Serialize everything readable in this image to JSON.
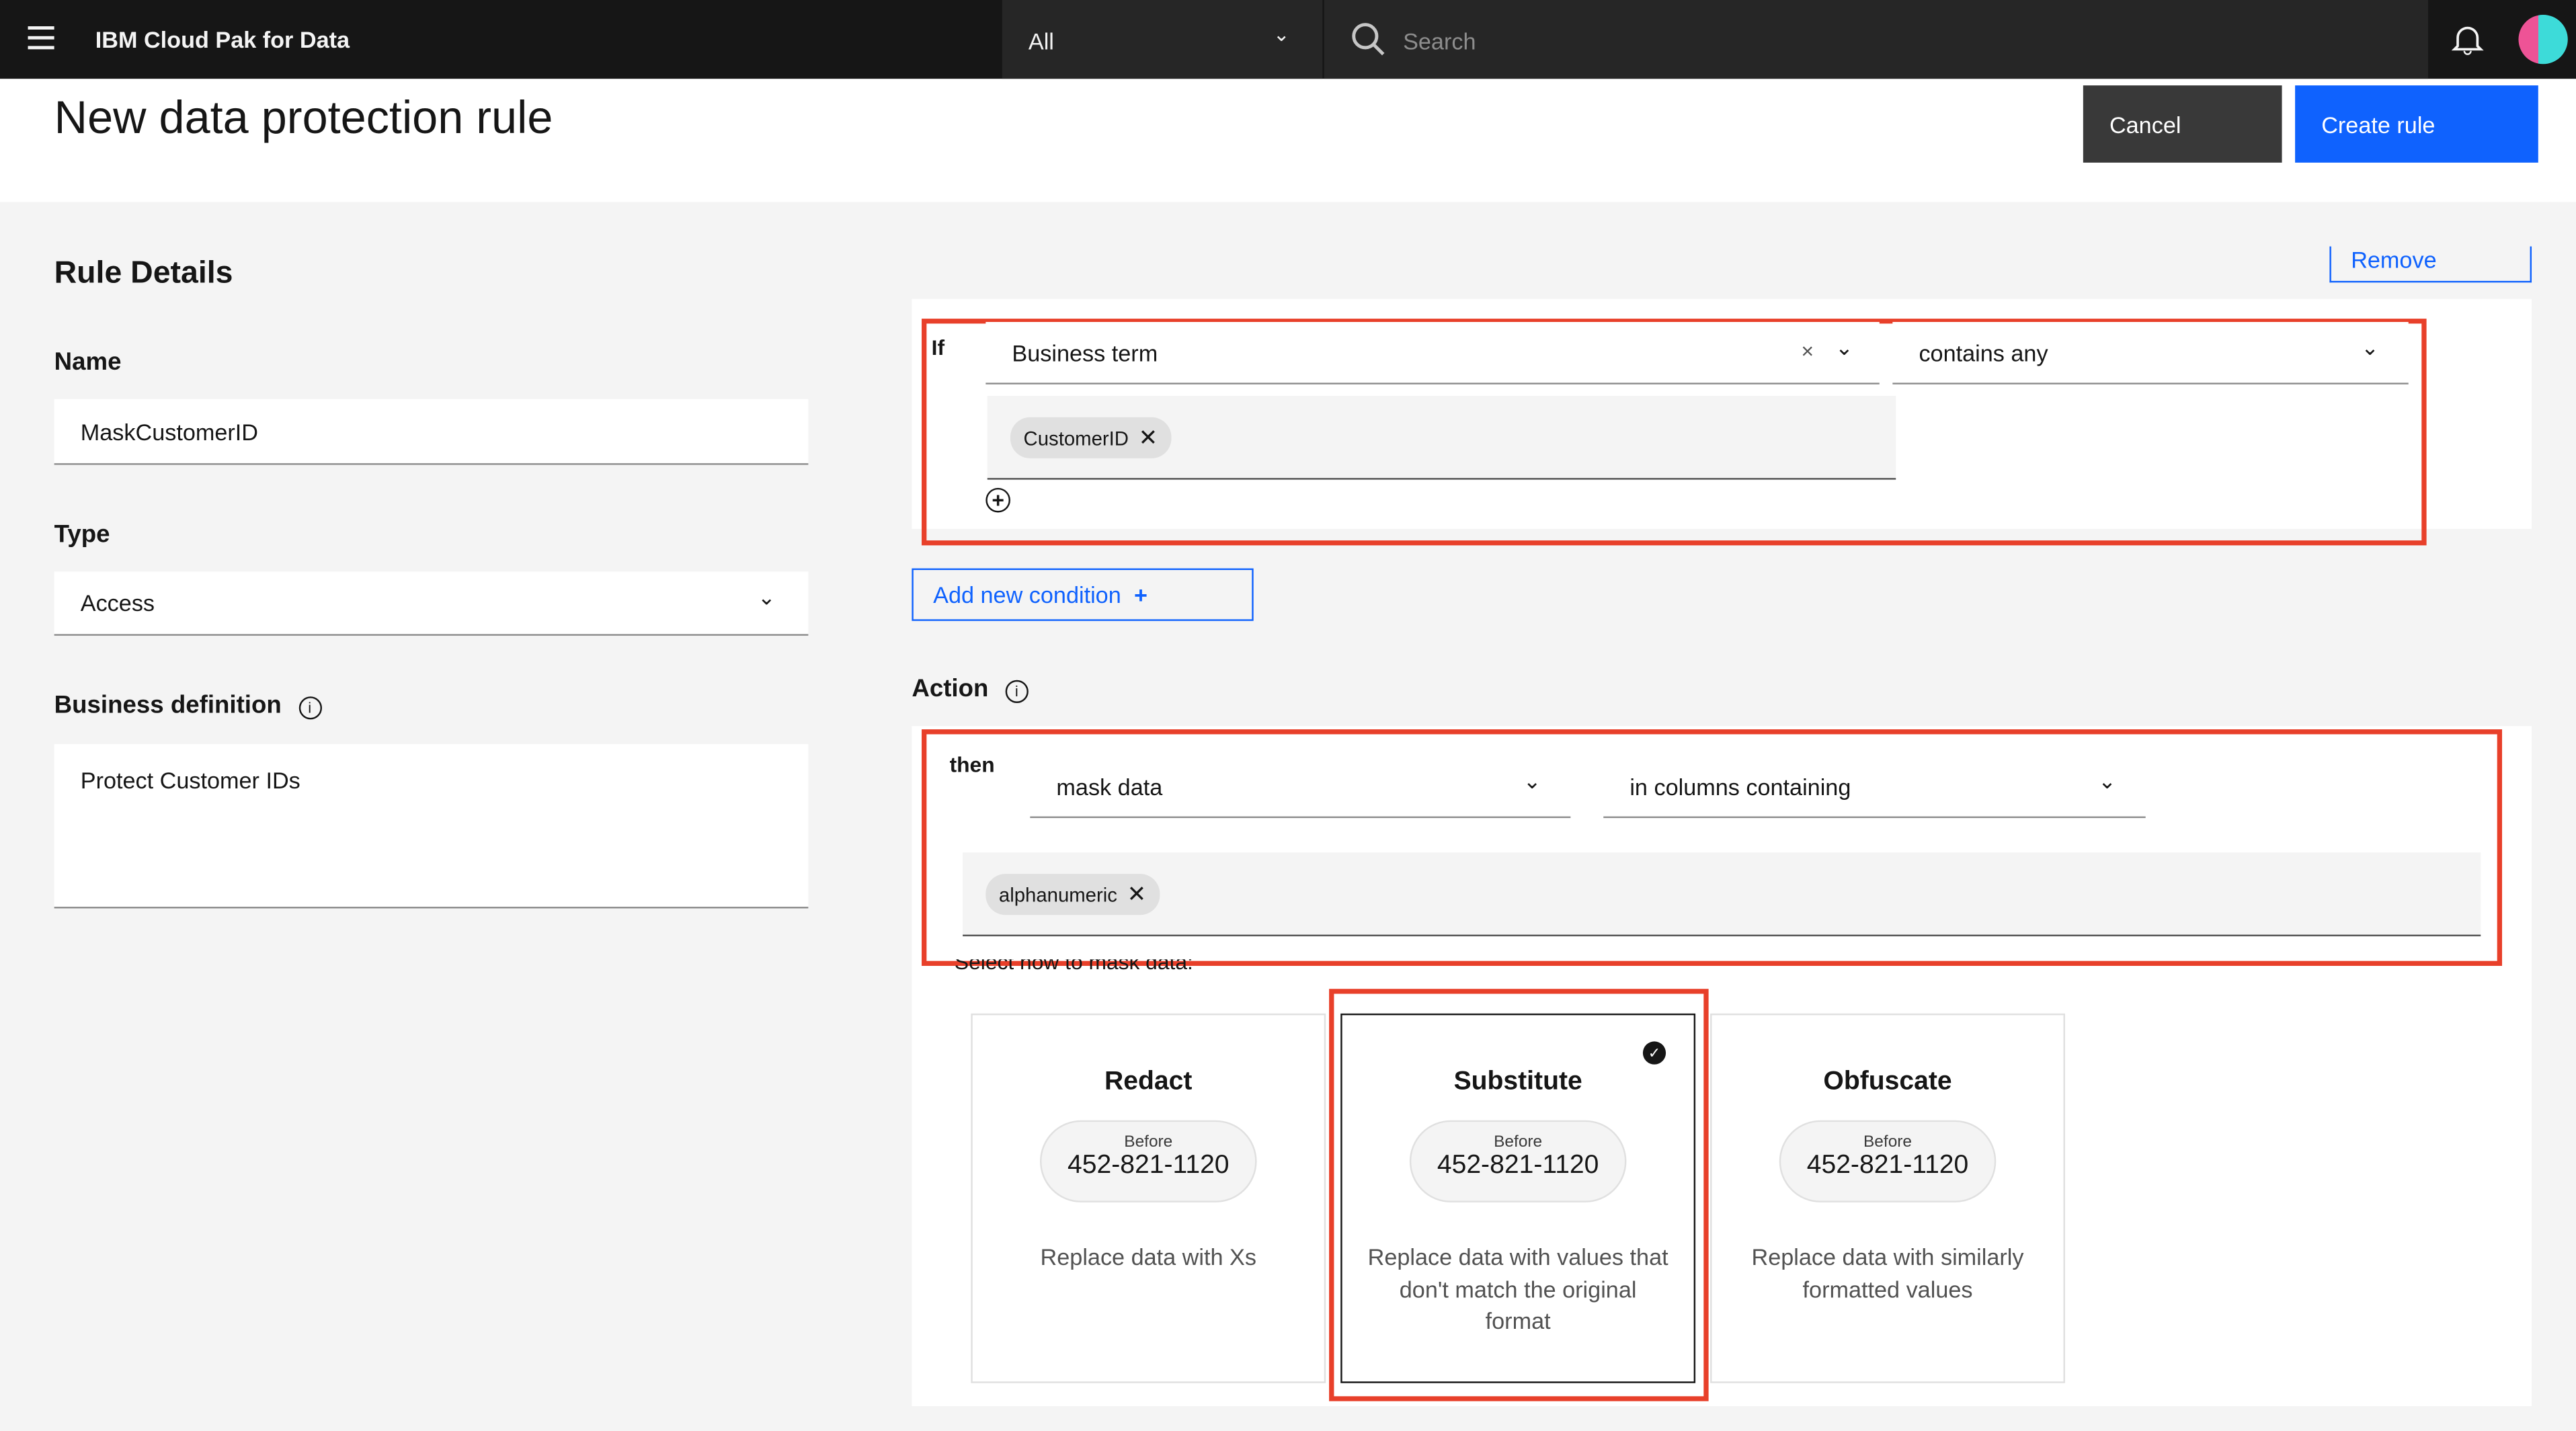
{
  "topbar": {
    "app_title": "IBM Cloud Pak for Data",
    "scope": "All",
    "search_placeholder": "Search"
  },
  "header": {
    "title": "New data protection rule",
    "cancel": "Cancel",
    "create": "Create rule"
  },
  "details": {
    "heading": "Rule Details",
    "name_label": "Name",
    "name_value": "MaskCustomerID",
    "type_label": "Type",
    "type_value": "Access",
    "definition_label": "Business definition",
    "definition_value": "Protect Customer IDs"
  },
  "condition": {
    "remove": "Remove",
    "if": "If",
    "property": "Business term",
    "operator": "contains any",
    "tags": [
      "CustomerID"
    ],
    "add_condition": "Add new condition"
  },
  "action": {
    "heading": "Action",
    "then": "then",
    "verb": "mask data",
    "scope": "in columns containing",
    "tags": [
      "alphanumeric"
    ],
    "select_label": "Select how to mask data:",
    "options": [
      {
        "title": "Redact",
        "before": "Before",
        "sample": "452-821-1120",
        "desc": "Replace data with Xs",
        "selected": false
      },
      {
        "title": "Substitute",
        "before": "Before",
        "sample": "452-821-1120",
        "desc": "Replace data with values that don't match the original format",
        "selected": true
      },
      {
        "title": "Obfuscate",
        "before": "Before",
        "sample": "452-821-1120",
        "desc": "Replace data with similarly formatted values",
        "selected": false
      }
    ]
  },
  "colors": {
    "primary": "#0f62fe",
    "highlight": "#e8402a",
    "topbar": "#161616"
  }
}
